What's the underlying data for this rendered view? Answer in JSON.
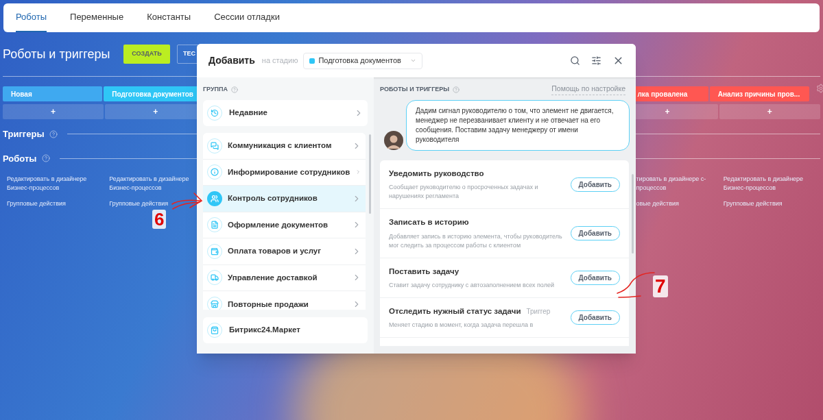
{
  "tabs": [
    {
      "label": "Роботы",
      "selected": true
    },
    {
      "label": "Переменные",
      "selected": false
    },
    {
      "label": "Константы",
      "selected": false
    },
    {
      "label": "Сессии отладки",
      "selected": false
    }
  ],
  "title": "Роботы и триггеры",
  "create_button": "СОЗДАТЬ",
  "second_button": "ТЕС",
  "stages": [
    {
      "label": "Новая",
      "color": "#3fa9f0"
    },
    {
      "label": "Подготовка документов",
      "color": "#2fc6f6"
    },
    {
      "label": "лка провалена",
      "color": "#ff5752"
    },
    {
      "label": "Анализ причины пров...",
      "color": "#ff5752"
    }
  ],
  "add_stage_symbol": "+",
  "sections": [
    {
      "label": "Триггеры"
    },
    {
      "label": "Роботы"
    }
  ],
  "column_links": [
    {
      "edit": "Редактировать в дизайнере Бизнес-процессов",
      "group": "Групповые действия"
    },
    {
      "edit": "Редактировать в дизайнере Бизнес-процессов",
      "group": "Групповые действия"
    },
    {
      "edit": "тировать в дизайнере с-процессов",
      "group": "овые действия"
    },
    {
      "edit": "Редактировать в дизайнере Бизнес-процессов",
      "group": "Групповые действия"
    }
  ],
  "modal": {
    "title": "Добавить",
    "stage_prefix": "на стадию",
    "stage": "Подготовка документов",
    "group_heading": "ГРУППА",
    "recent": {
      "label": "Недавние"
    },
    "groups": [
      {
        "label": "Коммуникация с клиентом",
        "selected": false
      },
      {
        "label": "Информирование сотрудников",
        "selected": false
      },
      {
        "label": "Контроль сотрудников",
        "selected": true
      },
      {
        "label": "Оформление документов",
        "selected": false
      },
      {
        "label": "Оплата товаров и услуг",
        "selected": false
      },
      {
        "label": "Управление доставкой",
        "selected": false
      },
      {
        "label": "Повторные продажи",
        "selected": false
      }
    ],
    "market": {
      "label": "Битрикс24.Маркет"
    },
    "right_heading": "РОБОТЫ И ТРИГГЕРЫ",
    "help_link": "Помощь по настройке",
    "hint": "Дадим сигнал руководителю о том, что элемент не двигается, менеджер не перезванивает клиенту и не отвечает на его сообщения. Поставим задачу менеджеру от имени руководителя",
    "robots": [
      {
        "title": "Уведомить руководство",
        "description": "Сообщает руководителю о просроченных задачах и нарушениях регламента",
        "button": "Добавить"
      },
      {
        "title": "Записать в историю",
        "description": "Добавляет запись в историю элемента, чтобы руководитель мог следить за процессом работы с клиентом",
        "button": "Добавить"
      },
      {
        "title": "Поставить задачу",
        "description": "Ставит задачу сотруднику с автозаполнением всех полей",
        "button": "Добавить"
      },
      {
        "title": "Отследить нужный статус задачи",
        "tag": "Триггер",
        "description": "Меняет стадию в момент, когда задача перешла в",
        "button": "Добавить"
      }
    ]
  },
  "annotations": [
    {
      "label": "6"
    },
    {
      "label": "7"
    }
  ]
}
